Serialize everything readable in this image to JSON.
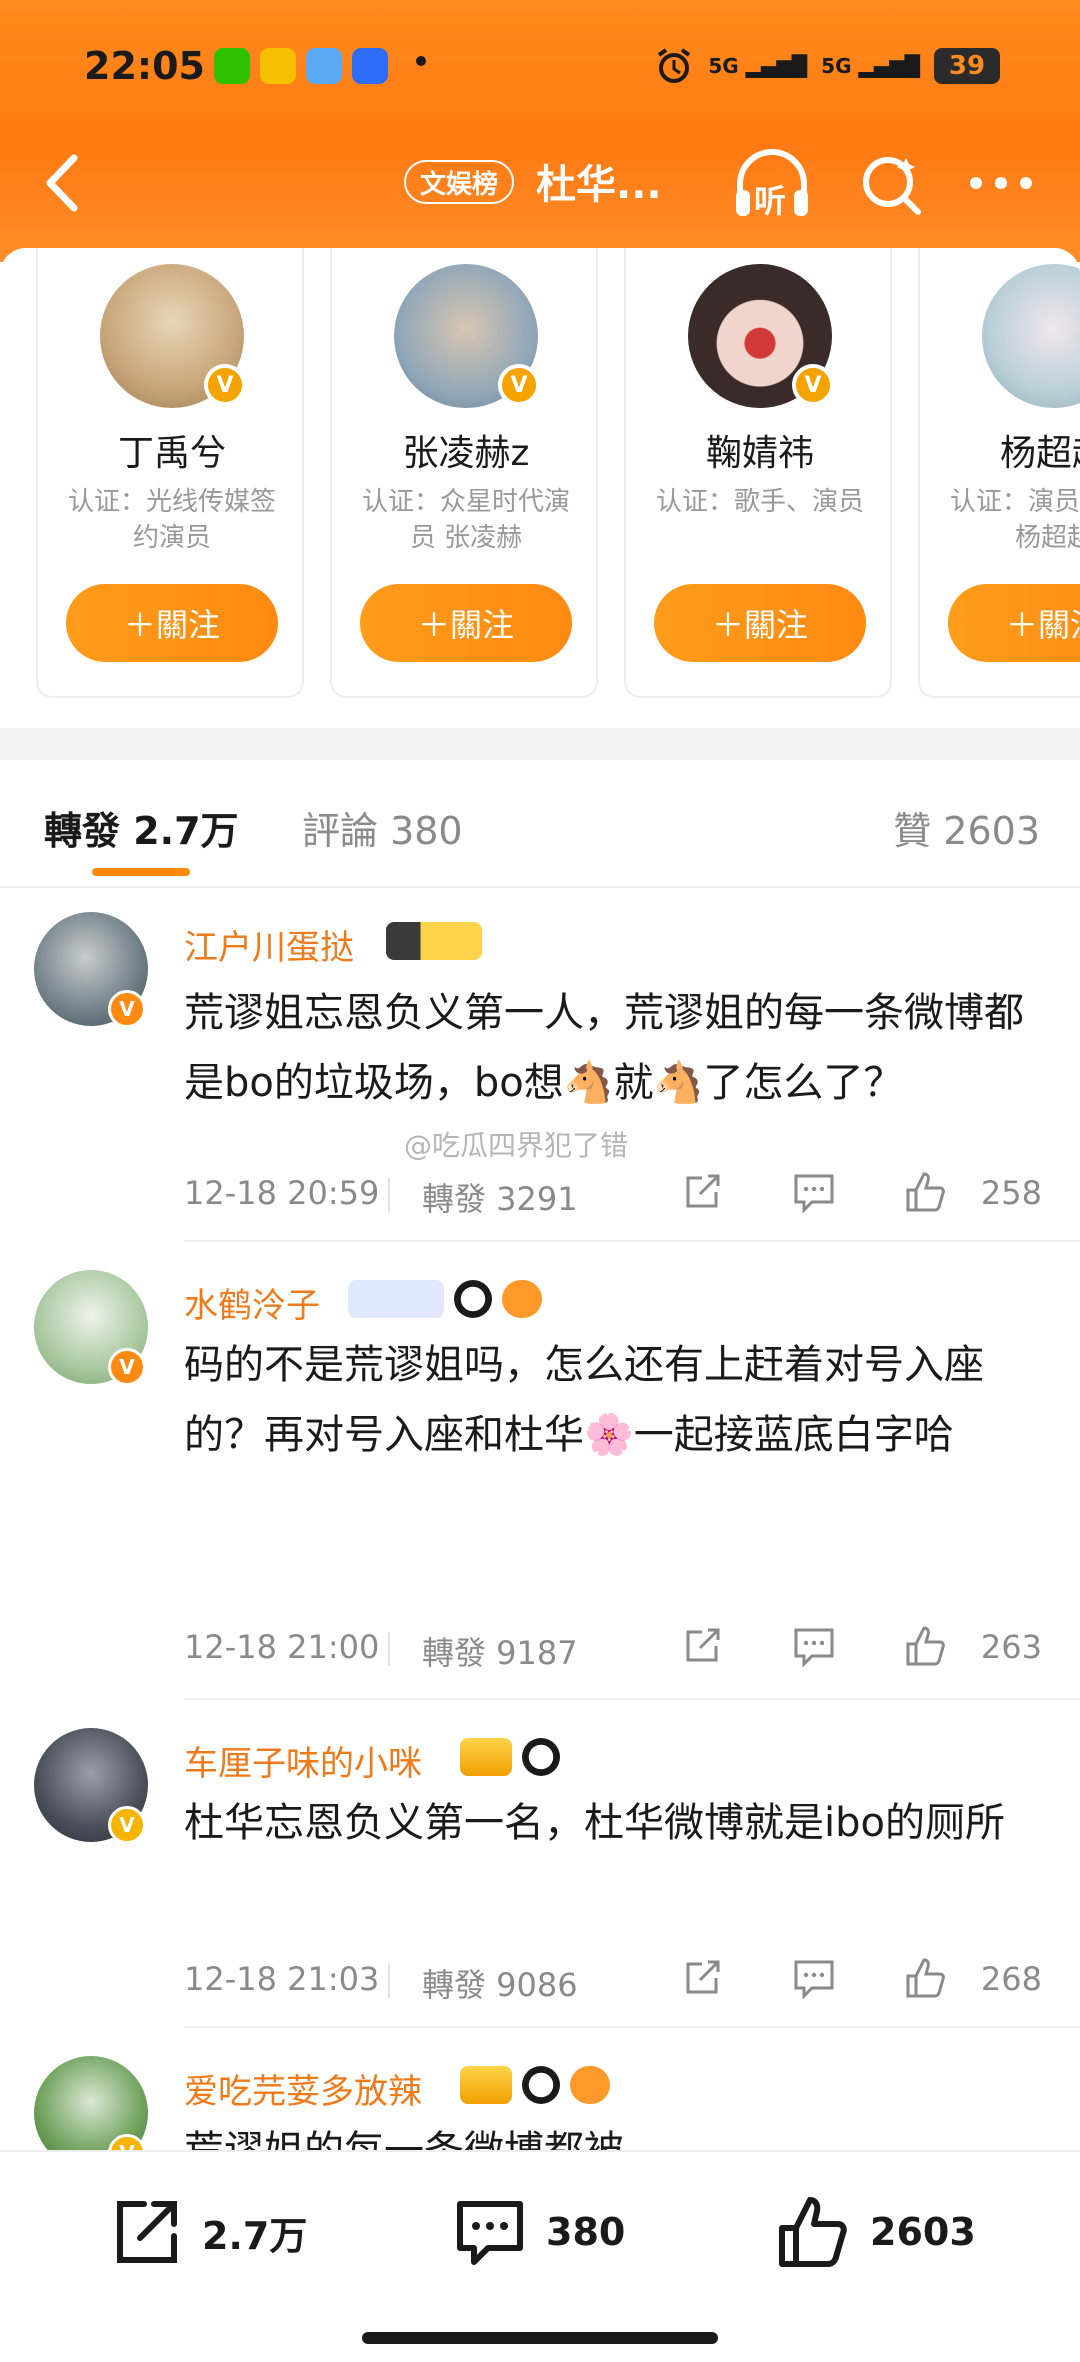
{
  "status_bar": {
    "time": "22:05",
    "signal1": "5G",
    "signal2": "5G",
    "battery": "39"
  },
  "topbar": {
    "badge": "文娱榜",
    "title": "杜华...",
    "listen_icon_label": "听"
  },
  "suggested_users": [
    {
      "name": "丁禹兮",
      "cert": "认证：光线传媒签约演员",
      "follow": "＋關注",
      "avatar_color": "#c8a67a"
    },
    {
      "name": "张凌赫z",
      "cert": "认证：众星时代演员 张凌赫",
      "follow": "＋關注",
      "avatar_color": "#8ea6b8"
    },
    {
      "name": "鞠婧祎",
      "cert": "认证：歌手、演员",
      "follow": "＋關注",
      "avatar_color": "#3a2a2a"
    },
    {
      "name": "杨超越",
      "cert": "认证：演员、歌手杨超越",
      "follow": "＋關注",
      "avatar_color": "#b9d0d8"
    }
  ],
  "tabs": {
    "repost": "轉發 2.7万",
    "comment": "評論 380",
    "like": "贊 2603"
  },
  "watermark": "@吃瓜四界犯了错",
  "comments": [
    {
      "user": "江户川蛋挞",
      "text": "荒谬姐忘恩负义第一人，荒谬姐的每一条微博都是bo的垃圾场，bo想🐴就🐴了怎么了？",
      "date": "12-18 20:59",
      "repost": "轉發 3291",
      "likes": "258",
      "avatar_color": "#6f7e86",
      "vbadge_color": "#ff8a12"
    },
    {
      "user": "水鹤泠子",
      "text": "码的不是荒谬姐吗，怎么还有上赶着对号入座的？再对号入座和杜华🌸一起接蓝底白字哈",
      "date": "12-18 21:00",
      "repost": "轉發 9187",
      "likes": "263",
      "avatar_color": "#a9c9a0",
      "vbadge_color": "#ff8a12"
    },
    {
      "user": "车厘子味的小咪",
      "text": "杜华忘恩负义第一名，杜华微博就是ibo的厕所",
      "date": "12-18 21:03",
      "repost": "轉發 9086",
      "likes": "268",
      "avatar_color": "#4a4f5a",
      "vbadge_color": "#f5b400"
    },
    {
      "user": "爱吃芫荽多放辣",
      "text": "荒谬姐的每一条微博都被",
      "avatar_color": "#6da05a",
      "vbadge_color": "#f5b400"
    }
  ],
  "bottom_bar": {
    "repost": "2.7万",
    "comment": "380",
    "like": "2603"
  }
}
